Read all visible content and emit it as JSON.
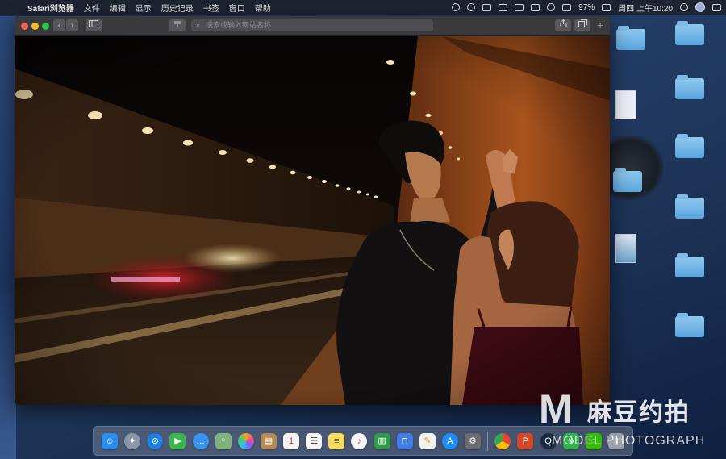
{
  "menubar": {
    "apple_icon": "apple-icon",
    "app_name": "Safari浏览器",
    "menus": [
      "文件",
      "编辑",
      "显示",
      "历史记录",
      "书签",
      "窗口",
      "帮助"
    ],
    "battery": "97%",
    "clock": "周四 上午10:20"
  },
  "safari": {
    "address_placeholder": "搜索或输入网站名称",
    "back_glyph": "‹",
    "forward_glyph": "›",
    "new_tab_glyph": "+"
  },
  "dock": {
    "apps": [
      "finder",
      "launchpad",
      "safari",
      "facetime",
      "messages",
      "maps",
      "photos",
      "contacts",
      "calendar",
      "reminders",
      "notes",
      "music",
      "numbers",
      "keynote",
      "pages",
      "app-store",
      "system-preferences",
      "chrome",
      "powerpoint",
      "quicktime",
      "monitor",
      "wechat",
      "trash"
    ],
    "calendar_day": "1"
  },
  "desktop": {
    "items": [
      "folder",
      "folder",
      "image",
      "folder",
      "folder",
      "folder",
      "folder",
      "image",
      "folder",
      "folder"
    ]
  },
  "watermark": {
    "logo_letter": "M",
    "brand_cn": "麻豆约拍",
    "brand_en": "MODEL PHOTOGRAPH"
  },
  "colors": {
    "accent_traffic_red": "#fc5f57",
    "accent_traffic_yellow": "#fdbc2e",
    "accent_traffic_green": "#28c840",
    "folder_blue": "#5aa6df"
  }
}
